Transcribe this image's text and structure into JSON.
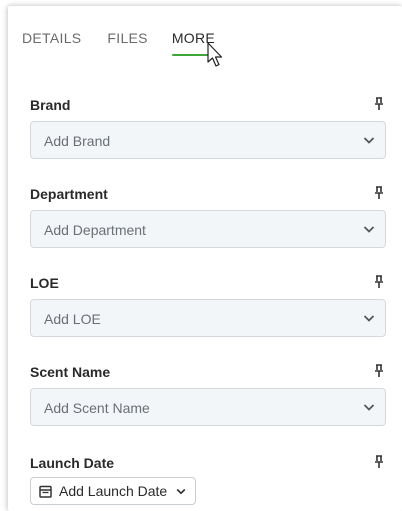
{
  "tabs": [
    {
      "label": "DETAILS"
    },
    {
      "label": "FILES"
    },
    {
      "label": "MORE"
    }
  ],
  "active_tab": "MORE",
  "fields": [
    {
      "label": "Brand",
      "placeholder": "Add Brand"
    },
    {
      "label": "Department",
      "placeholder": "Add Department"
    },
    {
      "label": "LOE",
      "placeholder": "Add LOE"
    },
    {
      "label": "Scent Name",
      "placeholder": "Add Scent Name"
    }
  ],
  "launch_date": {
    "label": "Launch Date",
    "button_label": "Add Launch Date"
  },
  "icons": {
    "pin": "pin-icon",
    "chevron": "chevron-down-icon",
    "calendar": "calendar-icon",
    "cursor": "mouse-cursor-icon"
  },
  "colors": {
    "active_tab_underline": "#3fa63a",
    "select_bg": "#f3f6f9",
    "select_border": "#d5d9dd"
  }
}
